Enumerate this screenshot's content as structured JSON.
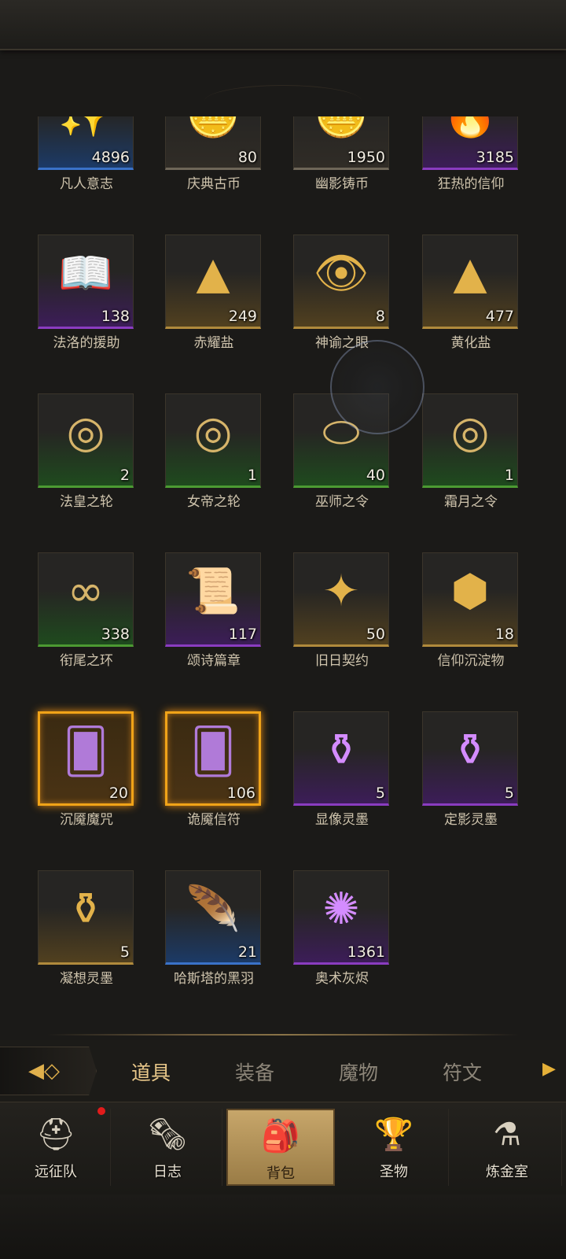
{
  "items": [
    {
      "name": "凡人意志",
      "count": "4896",
      "rarity": "blue",
      "icon": "✨"
    },
    {
      "name": "庆典古币",
      "count": "80",
      "rarity": "dark",
      "icon": "🪙"
    },
    {
      "name": "幽影铸币",
      "count": "1950",
      "rarity": "dark",
      "icon": "🪙"
    },
    {
      "name": "狂热的信仰",
      "count": "3185",
      "rarity": "purple",
      "icon": "🔥"
    },
    {
      "name": "法洛的援助",
      "count": "138",
      "rarity": "purple",
      "icon": "📖"
    },
    {
      "name": "赤耀盐",
      "count": "249",
      "rarity": "gold",
      "icon": "▲"
    },
    {
      "name": "神谕之眼",
      "count": "8",
      "rarity": "gold",
      "icon": "👁"
    },
    {
      "name": "黄化盐",
      "count": "477",
      "rarity": "gold",
      "icon": "▲"
    },
    {
      "name": "法皇之轮",
      "count": "2",
      "rarity": "green",
      "icon": "◎"
    },
    {
      "name": "女帝之轮",
      "count": "1",
      "rarity": "green",
      "icon": "◎"
    },
    {
      "name": "巫师之令",
      "count": "40",
      "rarity": "green",
      "icon": "⬭"
    },
    {
      "name": "霜月之令",
      "count": "1",
      "rarity": "green",
      "icon": "◎"
    },
    {
      "name": "衔尾之环",
      "count": "338",
      "rarity": "green",
      "icon": "∞"
    },
    {
      "name": "颂诗篇章",
      "count": "117",
      "rarity": "purple",
      "icon": "📜"
    },
    {
      "name": "旧日契约",
      "count": "50",
      "rarity": "gold",
      "icon": "✦"
    },
    {
      "name": "信仰沉淀物",
      "count": "18",
      "rarity": "gold",
      "icon": "⬢"
    },
    {
      "name": "沉魇魔咒",
      "count": "20",
      "rarity": "legendary",
      "icon": "🂠"
    },
    {
      "name": "诡魇信符",
      "count": "106",
      "rarity": "legendary",
      "icon": "🂠"
    },
    {
      "name": "显像灵墨",
      "count": "5",
      "rarity": "purple",
      "icon": "⚱"
    },
    {
      "name": "定影灵墨",
      "count": "5",
      "rarity": "purple",
      "icon": "⚱"
    },
    {
      "name": "凝想灵墨",
      "count": "5",
      "rarity": "gold",
      "icon": "⚱"
    },
    {
      "name": "哈斯塔的黑羽",
      "count": "21",
      "rarity": "blue",
      "icon": "🪶"
    },
    {
      "name": "奥术灰烬",
      "count": "1361",
      "rarity": "purple",
      "icon": "✺"
    }
  ],
  "tabs": {
    "items": "道具",
    "equipment": "装备",
    "monsters": "魔物",
    "runes": "符文"
  },
  "nav": {
    "expedition": "远征队",
    "journal": "日志",
    "backpack": "背包",
    "relics": "圣物",
    "alchemy": "炼金室"
  }
}
